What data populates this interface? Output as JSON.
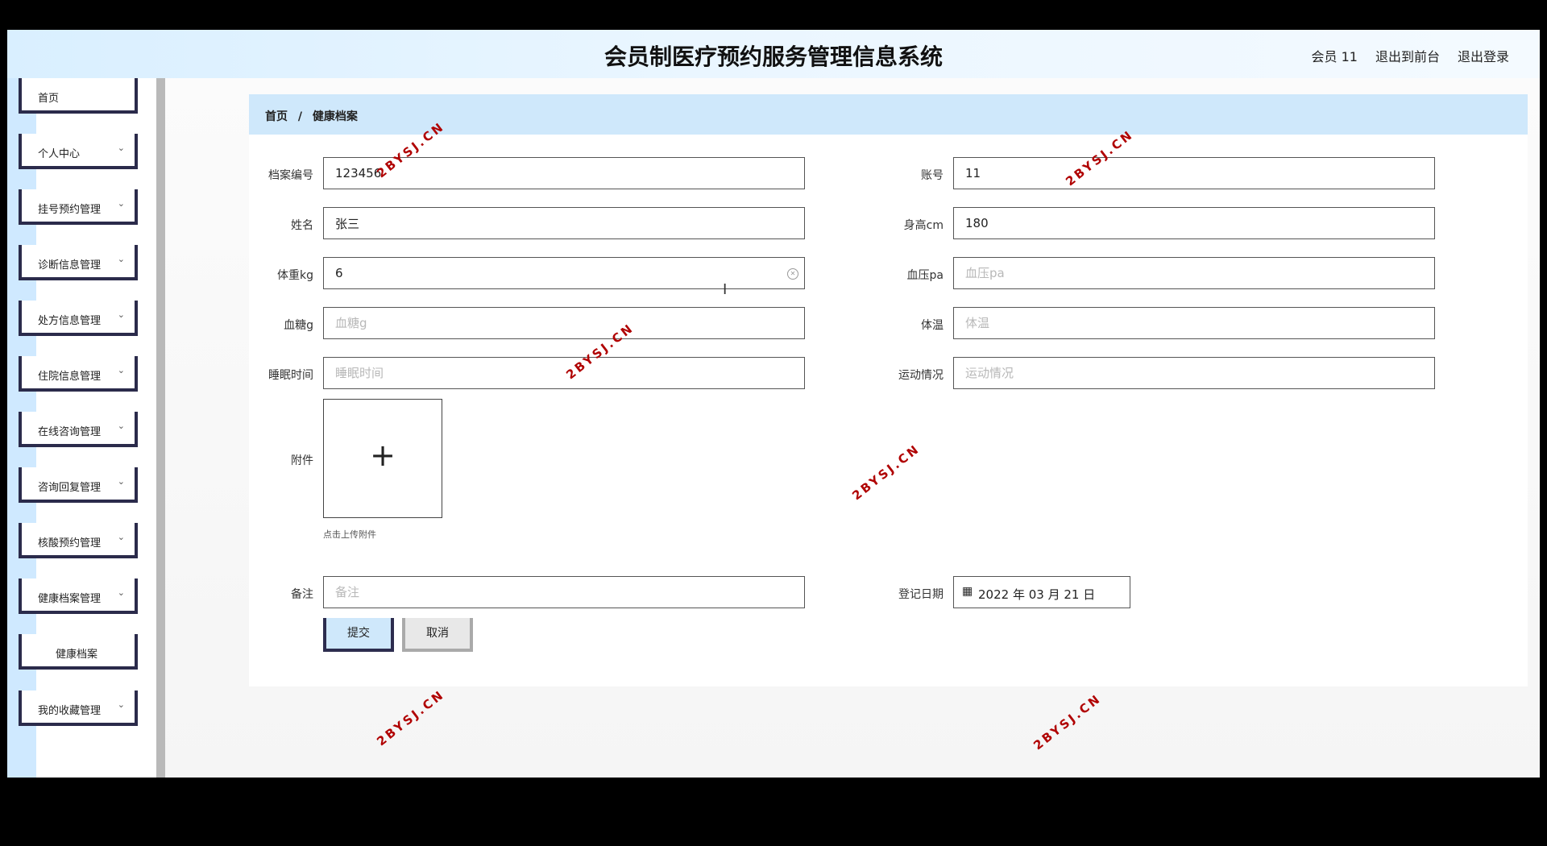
{
  "header": {
    "title": "会员制医疗预约服务管理信息系统",
    "user": "会员 11",
    "to_frontend": "退出到前台",
    "logout": "退出登录"
  },
  "sidebar": {
    "items": [
      {
        "label": "首页",
        "has_chevron": false
      },
      {
        "label": "个人中心",
        "has_chevron": true
      },
      {
        "label": "挂号预约管理",
        "has_chevron": true
      },
      {
        "label": "诊断信息管理",
        "has_chevron": true
      },
      {
        "label": "处方信息管理",
        "has_chevron": true
      },
      {
        "label": "住院信息管理",
        "has_chevron": true
      },
      {
        "label": "在线咨询管理",
        "has_chevron": true
      },
      {
        "label": "咨询回复管理",
        "has_chevron": true
      },
      {
        "label": "核酸预约管理",
        "has_chevron": true
      },
      {
        "label": "健康档案管理",
        "has_chevron": true
      },
      {
        "label": "健康档案",
        "has_chevron": false
      },
      {
        "label": "我的收藏管理",
        "has_chevron": true
      }
    ],
    "chevron_glyph": "⌄"
  },
  "breadcrumb": {
    "home": "首页",
    "separator": "/",
    "current": "健康档案"
  },
  "form": {
    "archive_no": {
      "label": "档案编号",
      "value": "123456",
      "placeholder": "档案编号"
    },
    "account": {
      "label": "账号",
      "value": "11",
      "placeholder": "账号"
    },
    "name": {
      "label": "姓名",
      "value": "张三",
      "placeholder": "姓名"
    },
    "height": {
      "label": "身高cm",
      "value": "180",
      "placeholder": "身高cm"
    },
    "weight": {
      "label": "体重kg",
      "value": "6",
      "placeholder": "体重kg"
    },
    "blood_pressure": {
      "label": "血压pa",
      "value": "",
      "placeholder": "血压pa"
    },
    "blood_sugar": {
      "label": "血糖g",
      "value": "",
      "placeholder": "血糖g"
    },
    "temperature": {
      "label": "体温",
      "value": "",
      "placeholder": "体温"
    },
    "sleep_time": {
      "label": "睡眠时间",
      "value": "",
      "placeholder": "睡眠时间"
    },
    "exercise": {
      "label": "运动情况",
      "value": "",
      "placeholder": "运动情况"
    },
    "attachment": {
      "label": "附件",
      "plus": "+",
      "hint": "点击上传附件"
    },
    "remark": {
      "label": "备注",
      "value": "",
      "placeholder": "备注"
    },
    "register_date": {
      "label": "登记日期",
      "value": "2022 年 03 月 21 日",
      "icon": "calendar-icon"
    },
    "submit": "提交",
    "cancel": "取消"
  },
  "watermark": "2BYSJ.CN",
  "colors": {
    "topbar": "#d9efff",
    "breadcrumb_bg": "#cfe8fb",
    "sidebar_strip": "#cfe9ff",
    "menu_border": "#2b2b4b",
    "watermark": "#b00000"
  }
}
